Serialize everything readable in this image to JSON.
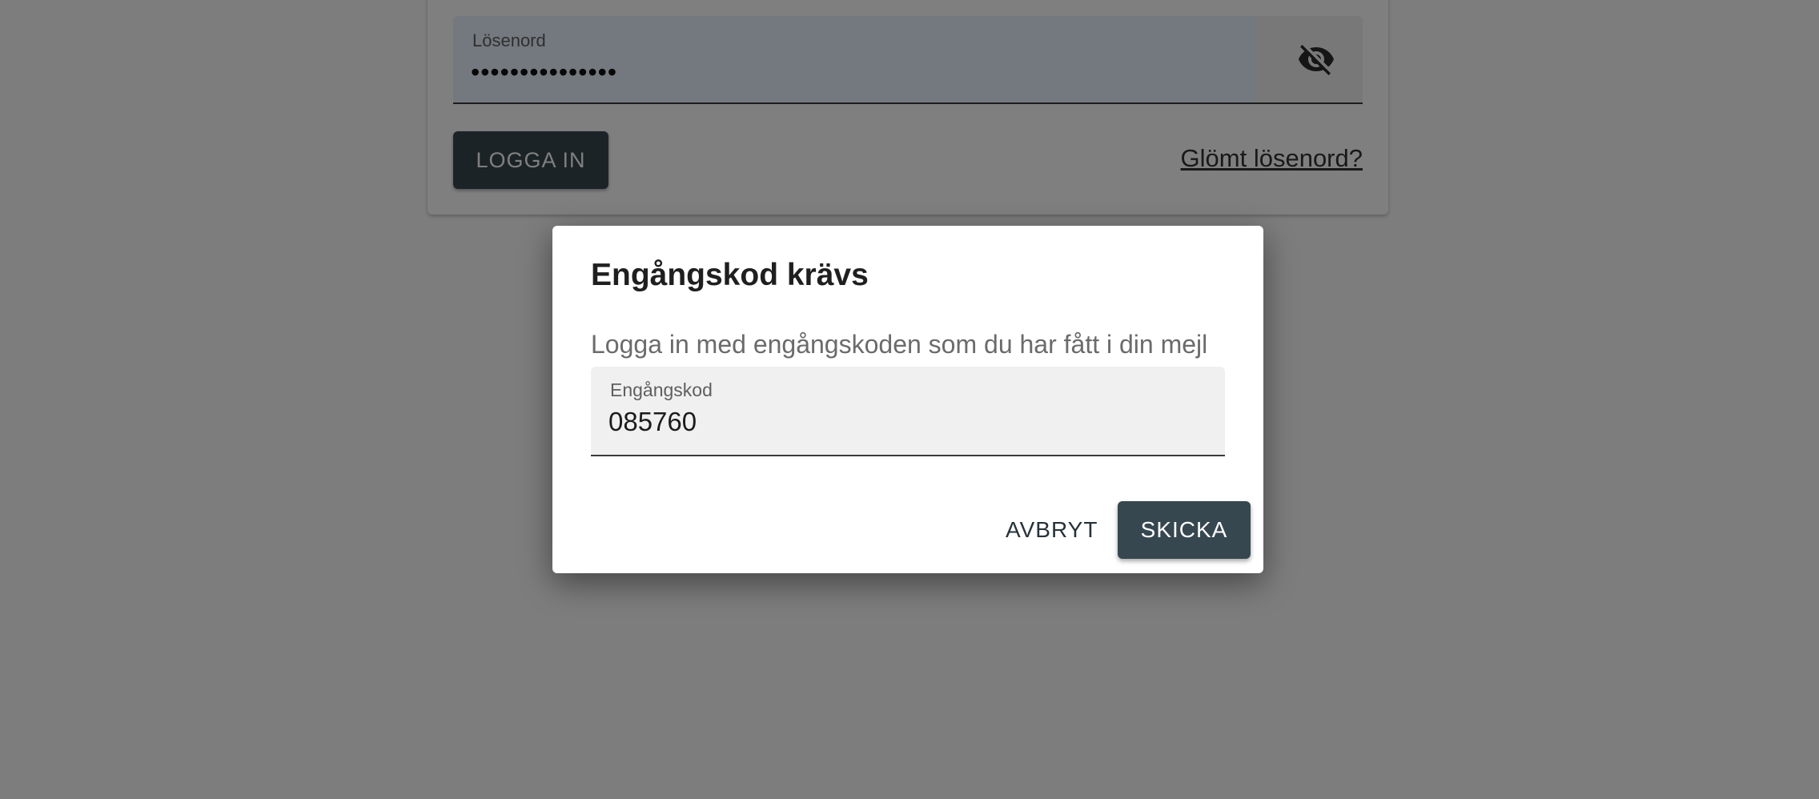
{
  "login": {
    "password_label": "Lösenord",
    "password_value": "•••••••••••••••",
    "login_button": "LOGGA IN",
    "forgot_link": "Glömt lösenord?",
    "visibility_icon": "visibility-off-icon"
  },
  "dialog": {
    "title": "Engångskod krävs",
    "text": "Logga in med engångskoden som du har fått i din mejl",
    "code_label": "Engångskod",
    "code_value": "085760",
    "cancel_label": "AVBRYT",
    "submit_label": "SKICKA"
  },
  "colors": {
    "primary_button": "#37474f",
    "backdrop": "rgba(0,0,0,0.5)",
    "autofill_field": "#e8f0fe"
  }
}
